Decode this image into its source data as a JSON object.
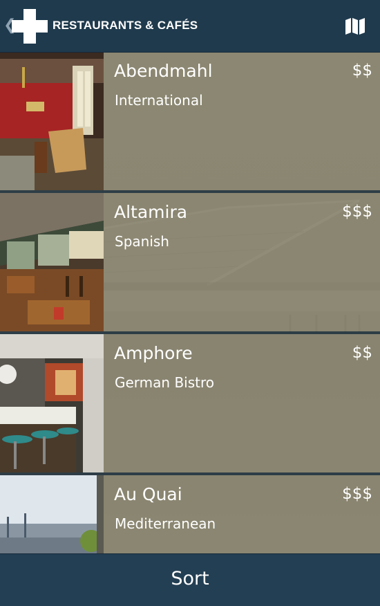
{
  "header": {
    "title": "RESTAURANTS & CAFÉS",
    "back_glyph": "❮",
    "logo_icon": "plus-cross-logo",
    "map_icon": "map-icon"
  },
  "restaurants": [
    {
      "name": "Abendmahl",
      "price": "$$",
      "cuisine": "International"
    },
    {
      "name": "Altamira",
      "price": "$$$",
      "cuisine": "Spanish"
    },
    {
      "name": "Amphore",
      "price": "$$",
      "cuisine": "German Bistro"
    },
    {
      "name": "Au Quai",
      "price": "$$$",
      "cuisine": "Mediterranean"
    }
  ],
  "footer": {
    "sort_label": "Sort"
  },
  "colors": {
    "header_bg": "#1f3a4d",
    "footer_bg": "#233f53",
    "panel_overlay": "#8b8670",
    "text": "#ffffff"
  }
}
